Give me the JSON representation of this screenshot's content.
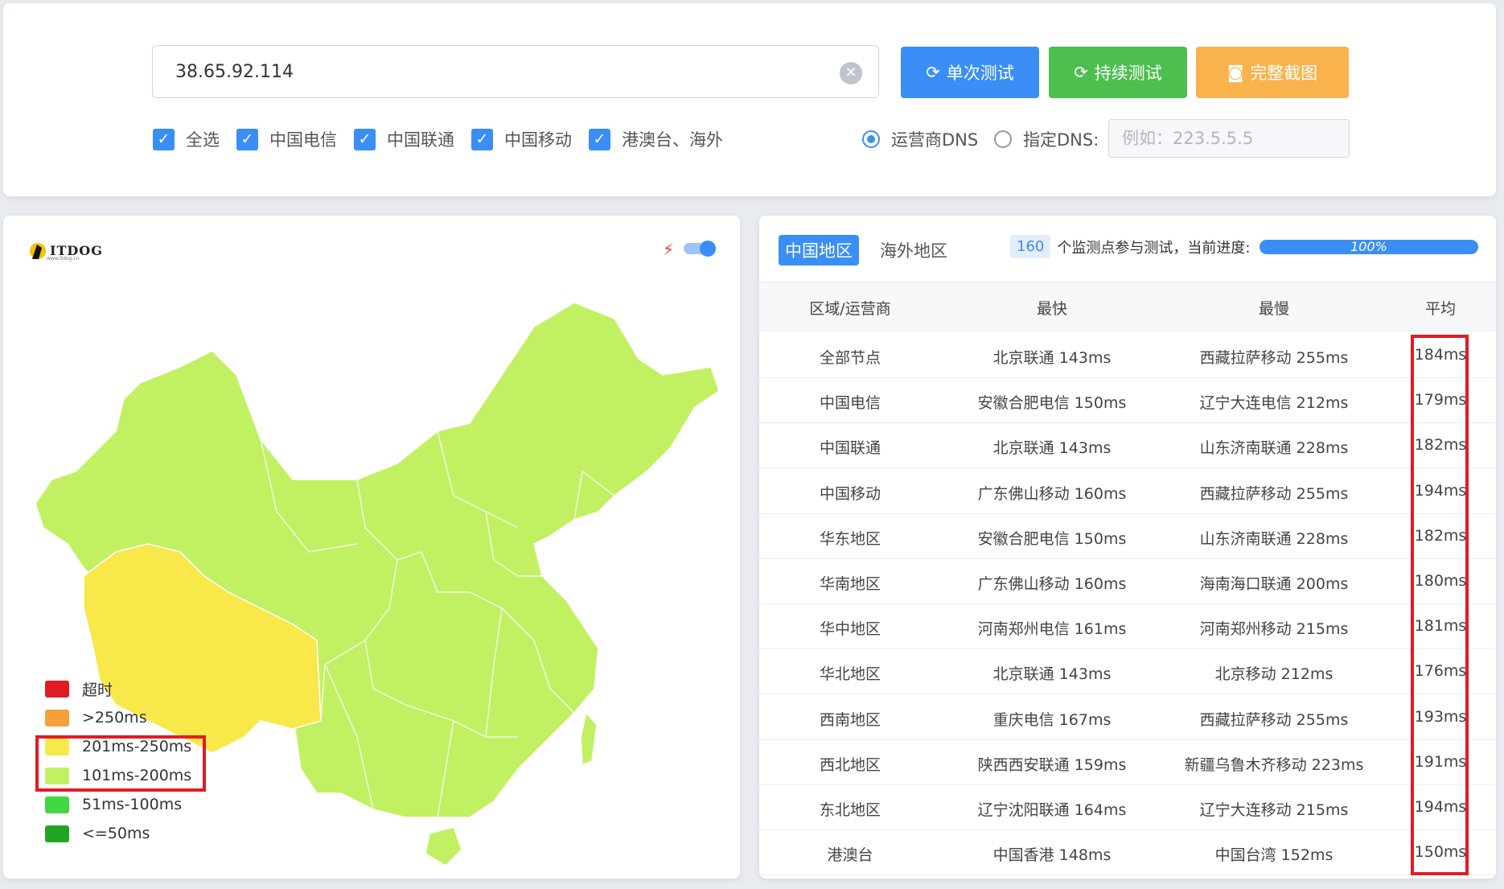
{
  "search": {
    "ip": "38.65.92.114"
  },
  "buttons": {
    "single": "单次测试",
    "continuous": "持续测试",
    "screenshot": "完整截图"
  },
  "checks": [
    {
      "label": "全选"
    },
    {
      "label": "中国电信"
    },
    {
      "label": "中国联通"
    },
    {
      "label": "中国移动"
    },
    {
      "label": "港澳台、海外"
    }
  ],
  "dns": {
    "isp_label": "运营商DNS",
    "custom_label": "指定DNS:",
    "placeholder": "例如：223.5.5.5"
  },
  "logo": {
    "text": "ITDOG",
    "sub": "www.itdog.cn"
  },
  "legend": [
    {
      "label": "超时",
      "color": "#e01b24"
    },
    {
      "label": ">250ms",
      "color": "#f5a03a"
    },
    {
      "label": "201ms-250ms",
      "color": "#f8e84a"
    },
    {
      "label": "101ms-200ms",
      "color": "#c2f063"
    },
    {
      "label": "51ms-100ms",
      "color": "#3fd83f"
    },
    {
      "label": "<=50ms",
      "color": "#22a522"
    }
  ],
  "tabs": {
    "china": "中国地区",
    "overseas": "海外地区"
  },
  "progress": {
    "count": "160",
    "text": "个监测点参与测试，当前进度:",
    "percent": "100%"
  },
  "table": {
    "headers": [
      "区域/运营商",
      "最快",
      "最慢",
      "平均"
    ],
    "rows": [
      [
        "全部节点",
        "北京联通 143ms",
        "西藏拉萨移动 255ms",
        "184ms"
      ],
      [
        "中国电信",
        "安徽合肥电信 150ms",
        "辽宁大连电信 212ms",
        "179ms"
      ],
      [
        "中国联通",
        "北京联通 143ms",
        "山东济南联通 228ms",
        "182ms"
      ],
      [
        "中国移动",
        "广东佛山移动 160ms",
        "西藏拉萨移动 255ms",
        "194ms"
      ],
      [
        "华东地区",
        "安徽合肥电信 150ms",
        "山东济南联通 228ms",
        "182ms"
      ],
      [
        "华南地区",
        "广东佛山移动 160ms",
        "海南海口联通 200ms",
        "180ms"
      ],
      [
        "华中地区",
        "河南郑州电信 161ms",
        "河南郑州移动 215ms",
        "181ms"
      ],
      [
        "华北地区",
        "北京联通 143ms",
        "北京移动 212ms",
        "176ms"
      ],
      [
        "西南地区",
        "重庆电信 167ms",
        "西藏拉萨移动 255ms",
        "193ms"
      ],
      [
        "西北地区",
        "陕西西安联通 159ms",
        "新疆乌鲁木齐移动 223ms",
        "191ms"
      ],
      [
        "东北地区",
        "辽宁沈阳联通 164ms",
        "辽宁大连移动 215ms",
        "194ms"
      ],
      [
        "港澳台",
        "中国香港 148ms",
        "中国台湾 152ms",
        "150ms"
      ]
    ]
  }
}
